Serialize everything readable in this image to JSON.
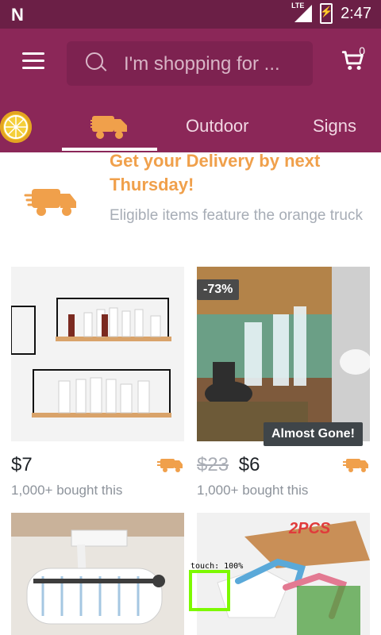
{
  "status_bar": {
    "time": "2:47",
    "network": "LTE"
  },
  "header": {
    "search": {
      "placeholder": "I'm shopping for ..."
    },
    "cart": {
      "count": "0"
    },
    "tabs": [
      "Outdoor",
      "Signs"
    ]
  },
  "banner": {
    "title": "Get your Delivery by next Thursday!",
    "subtitle": "Eligible items feature the orange truck"
  },
  "products": [
    {
      "price": "$7",
      "bought": "1,000+ bought this"
    },
    {
      "discount": "-73%",
      "old_price": "$23",
      "price": "$6",
      "badge": "Almost Gone!",
      "bought": "1,000+ bought this"
    },
    {
      "image_text": ""
    },
    {
      "image_text": "2PCS"
    }
  ],
  "overlay": {
    "touch_label": "touch: 100%"
  },
  "colors": {
    "brand": "#8b2758",
    "status": "#6b1f46",
    "orange": "#f0a04b"
  }
}
